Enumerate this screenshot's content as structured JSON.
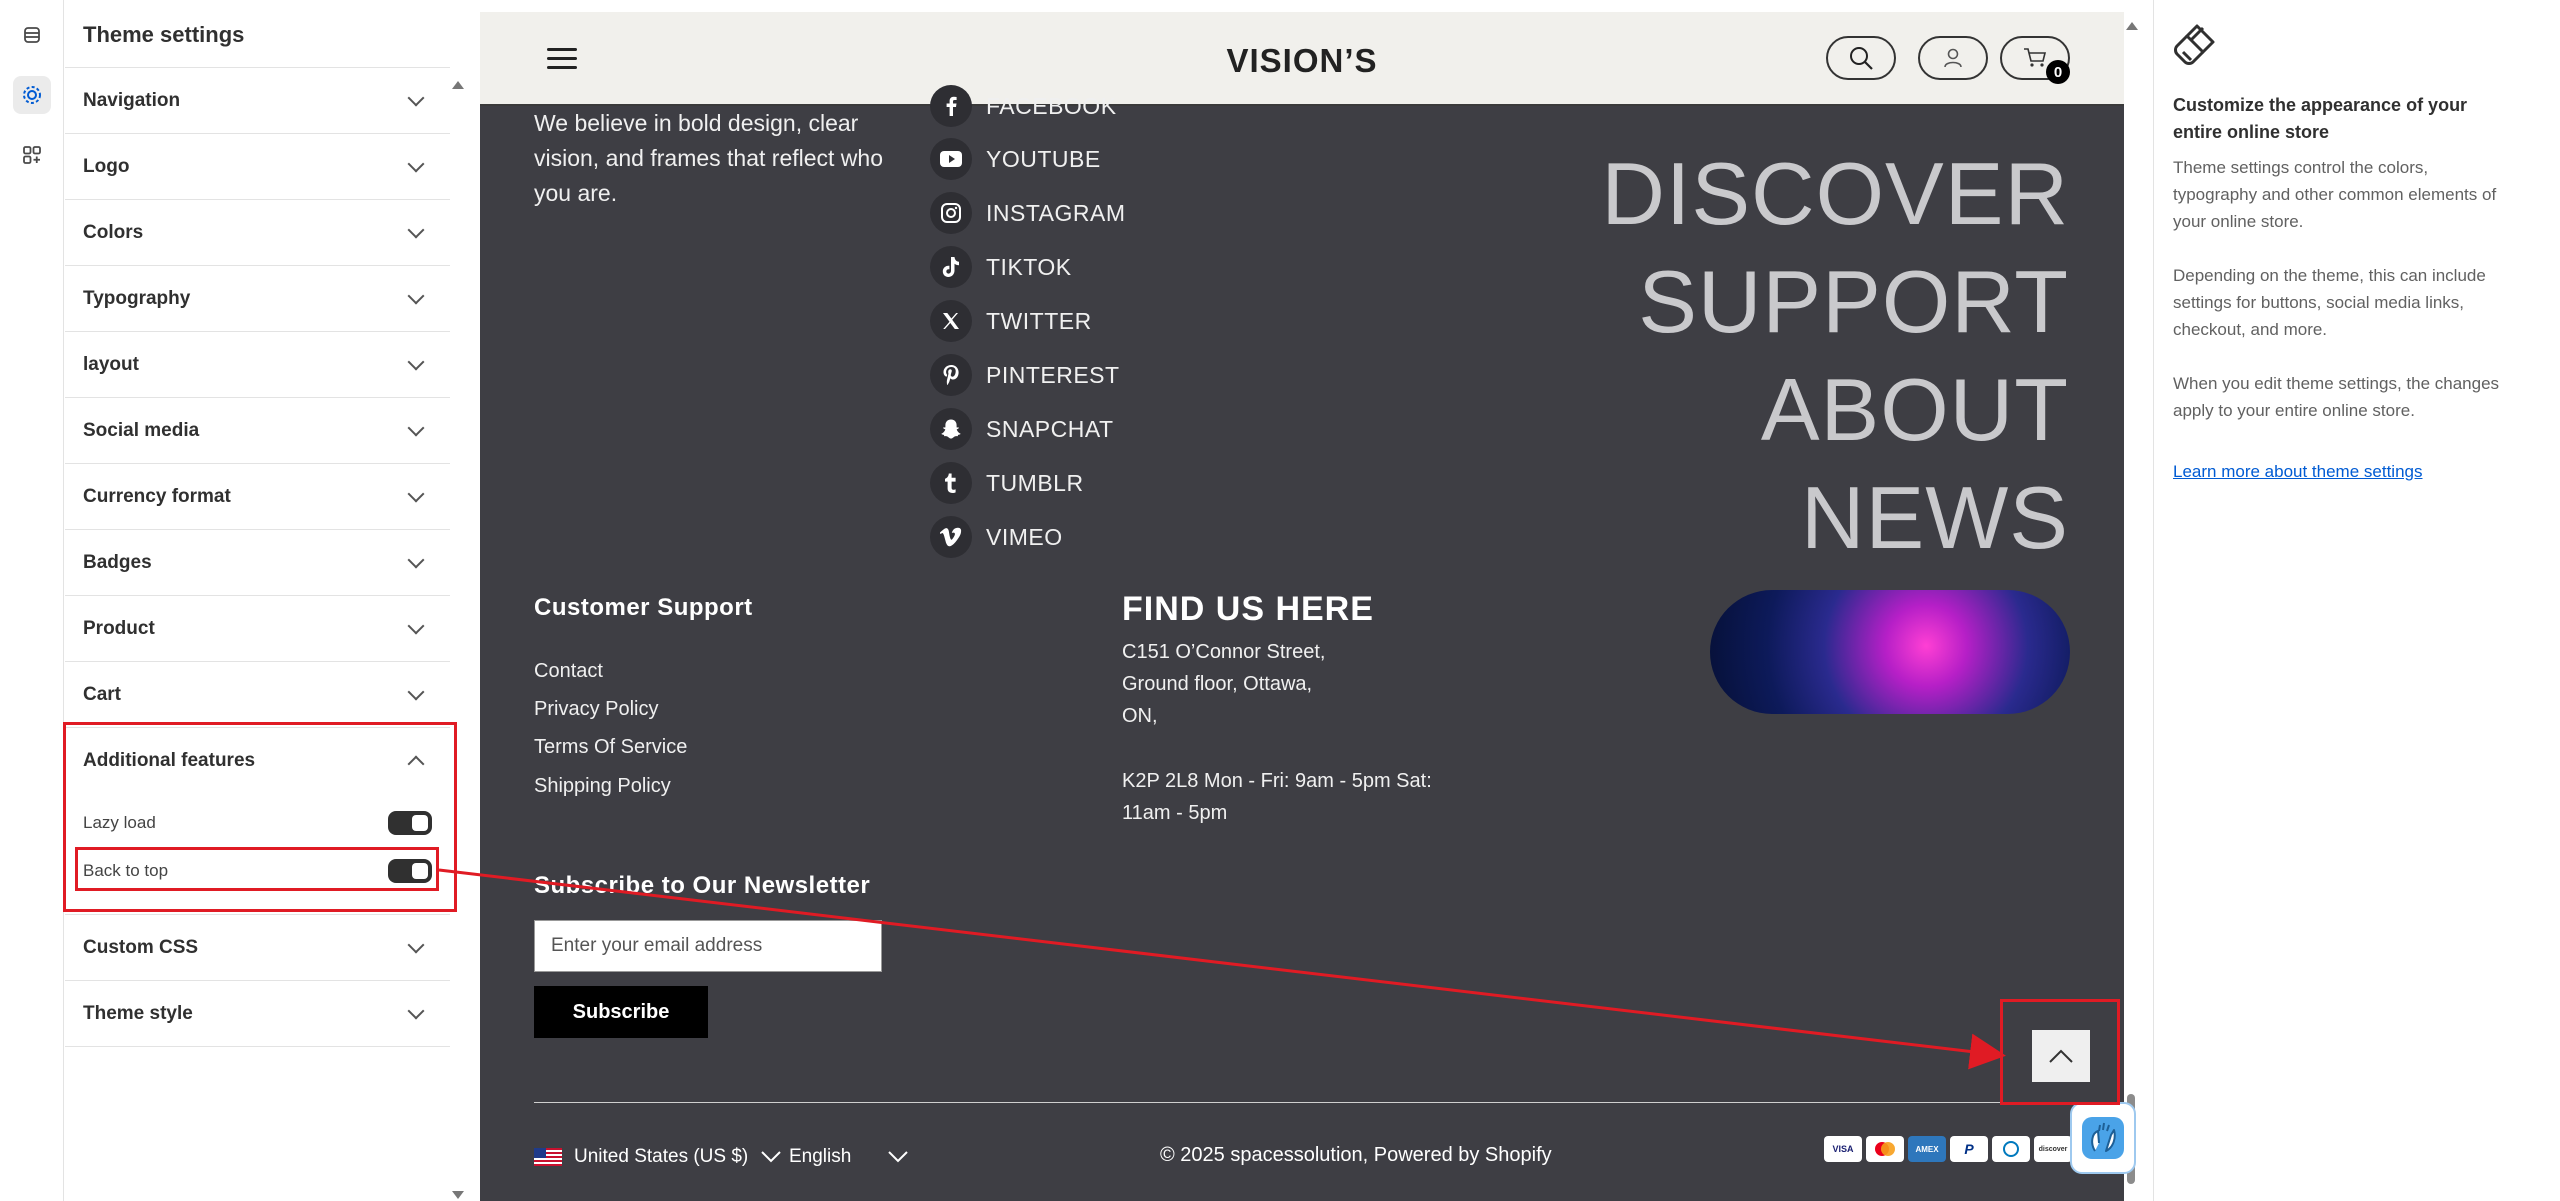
{
  "sidebar": {
    "title": "Theme settings",
    "sections": [
      {
        "label": "Navigation"
      },
      {
        "label": "Logo"
      },
      {
        "label": "Colors"
      },
      {
        "label": "Typography"
      },
      {
        "label": "layout"
      },
      {
        "label": "Social media"
      },
      {
        "label": "Currency format"
      },
      {
        "label": "Badges"
      },
      {
        "label": "Product"
      },
      {
        "label": "Cart"
      }
    ],
    "open_section": {
      "label": "Additional features",
      "toggles": [
        {
          "label": "Lazy load",
          "on": true
        },
        {
          "label": "Back to top",
          "on": true
        }
      ]
    },
    "after_sections": [
      {
        "label": "Custom CSS"
      },
      {
        "label": "Theme style"
      }
    ]
  },
  "rail": {
    "icons": [
      "sections-icon",
      "theme-settings-icon",
      "apps-icon"
    ]
  },
  "preview": {
    "brand": "VISION’S",
    "cart_count": "0",
    "tagline": "We believe in bold design, clear vision, and frames that reflect who you are.",
    "social": [
      "FACEBOOK",
      "YOUTUBE",
      "INSTAGRAM",
      "TIKTOK",
      "TWITTER",
      "PINTEREST",
      "SNAPCHAT",
      "TUMBLR",
      "VIMEO"
    ],
    "big_nav": [
      "DISCOVER",
      "SUPPORT",
      "ABOUT",
      "NEWS"
    ],
    "support_title": "Customer Support",
    "support_links": [
      "Contact",
      "Privacy Policy",
      "Terms Of Service",
      "Shipping Policy"
    ],
    "find_title": "FIND US HERE",
    "address_lines": [
      "C151 O’Connor Street,",
      "Ground floor, Ottawa,",
      "ON,",
      "",
      "K2P 2L8  Mon - Fri: 9am - 5pm Sat:",
      "11am - 5pm"
    ],
    "newsletter_title": "Subscribe to Our Newsletter",
    "email_placeholder": "Enter your email address",
    "subscribe_label": "Subscribe",
    "country": "United States (US $)",
    "language": "English",
    "copyright": "© 2025 spacessolution, Powered by Shopify",
    "payments": [
      "VISA",
      "MC",
      "AMEX",
      "PayPal",
      "Diners",
      "Discover"
    ]
  },
  "info": {
    "heading": "Customize the appearance of your entire online store",
    "p1": "Theme settings control the colors, typography and other common elements of your online store.",
    "p2": "Depending on the theme, this can include settings for buttons, social media links, checkout, and more.",
    "p3": "When you edit theme settings, the changes apply to your entire online store.",
    "link": "Learn more about theme settings"
  },
  "colors": {
    "highlight": "#e01b24",
    "footer_bg": "#3e3e44",
    "header_bg": "#f1f0ec",
    "link": "#005bd3"
  }
}
